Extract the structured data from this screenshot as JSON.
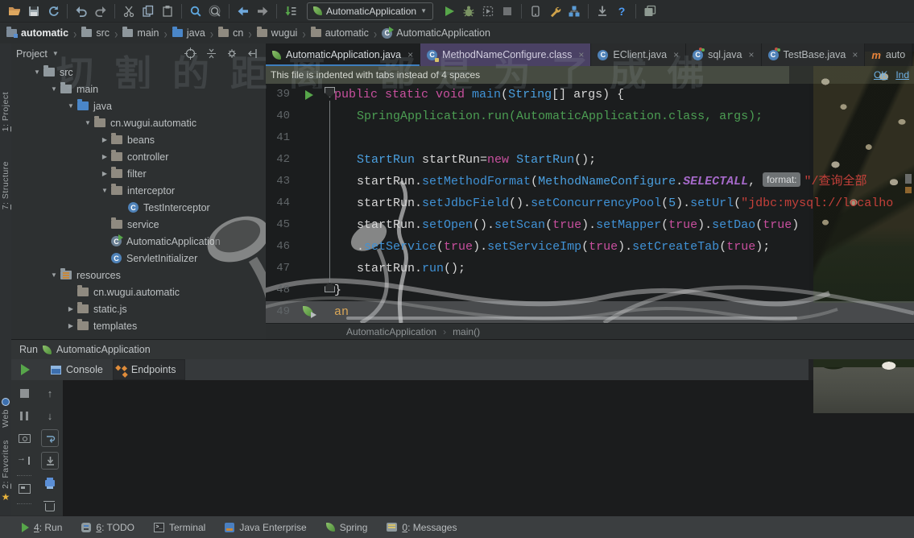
{
  "window": {
    "watermark": "切割的距离 都是为了成佛"
  },
  "toolbar": {
    "run_config": "AutomaticApplication"
  },
  "navbar": {
    "items": [
      {
        "label": "automatic",
        "icon": "project"
      },
      {
        "label": "src",
        "icon": "folder"
      },
      {
        "label": "main",
        "icon": "folder"
      },
      {
        "label": "java",
        "icon": "folder-blue"
      },
      {
        "label": "cn",
        "icon": "package"
      },
      {
        "label": "wugui",
        "icon": "package"
      },
      {
        "label": "automatic",
        "icon": "package"
      },
      {
        "label": "AutomaticApplication",
        "icon": "spring-class"
      }
    ]
  },
  "left_strip": {
    "top": [
      {
        "label": "1: Project",
        "icon": "project-tool"
      },
      {
        "label": "7: Structure",
        "icon": "structure-tool"
      }
    ],
    "bottom": [
      {
        "label": "Web",
        "icon": "web-tool"
      },
      {
        "label": "2: Favorites",
        "icon": "favorites-tool"
      }
    ]
  },
  "project_panel": {
    "title": "Project",
    "tree": [
      {
        "label": "src",
        "depth": 1,
        "arrow": "down",
        "icon": "folder"
      },
      {
        "label": "main",
        "depth": 2,
        "arrow": "down",
        "icon": "folder"
      },
      {
        "label": "java",
        "depth": 3,
        "arrow": "down",
        "icon": "folder-blue"
      },
      {
        "label": "cn.wugui.automatic",
        "depth": 4,
        "arrow": "down",
        "icon": "package"
      },
      {
        "label": "beans",
        "depth": 5,
        "arrow": "right",
        "icon": "package"
      },
      {
        "label": "controller",
        "depth": 5,
        "arrow": "right",
        "icon": "package"
      },
      {
        "label": "filter",
        "depth": 5,
        "arrow": "right",
        "icon": "package"
      },
      {
        "label": "interceptor",
        "depth": 5,
        "arrow": "down",
        "icon": "package"
      },
      {
        "label": "TestInterceptor",
        "depth": 6,
        "arrow": "none",
        "icon": "class"
      },
      {
        "label": "service",
        "depth": 5,
        "arrow": "none",
        "icon": "package"
      },
      {
        "label": "AutomaticApplication",
        "depth": 5,
        "arrow": "none",
        "icon": "spring-class"
      },
      {
        "label": "ServletInitializer",
        "depth": 5,
        "arrow": "none",
        "icon": "class"
      },
      {
        "label": "resources",
        "depth": 2,
        "arrow": "down",
        "icon": "resources"
      },
      {
        "label": "cn.wugui.automatic",
        "depth": 3,
        "arrow": "none",
        "icon": "package"
      },
      {
        "label": "static.js",
        "depth": 3,
        "arrow": "right",
        "icon": "package"
      },
      {
        "label": "templates",
        "depth": 3,
        "arrow": "right",
        "icon": "package"
      }
    ]
  },
  "editor": {
    "tabs": [
      {
        "label": "AutomaticApplication.java",
        "icon": "spring-boot-class",
        "state": "active",
        "close": true
      },
      {
        "label": "MethodNameConfigure.class",
        "icon": "class-locked",
        "state": "purple",
        "close": true
      },
      {
        "label": "EClient.java",
        "icon": "class",
        "state": "plain",
        "close": true
      },
      {
        "label": "sql.java",
        "icon": "class-modified",
        "state": "plain",
        "close": true
      },
      {
        "label": "TestBase.java",
        "icon": "class-modified",
        "state": "plain",
        "close": true
      },
      {
        "label": "auto",
        "icon": "maven",
        "state": "ghost",
        "close": false
      }
    ],
    "banner": {
      "text": "This file is indented with tabs instead of 4 spaces",
      "links": [
        "OK",
        "Ind"
      ]
    },
    "hint_label": "format:",
    "lines": [
      {
        "n": 39,
        "ind": 0,
        "run_icon": true,
        "seg": [
          [
            "kw",
            "public static void "
          ],
          [
            "m",
            "main"
          ],
          [
            "pl",
            "("
          ],
          [
            "type",
            "String"
          ],
          [
            "pl",
            "[] args) {"
          ]
        ]
      },
      {
        "n": 40,
        "ind": 1,
        "seg": [
          [
            "green",
            "SpringApplication.run(AutomaticApplication.class, args);"
          ]
        ]
      },
      {
        "n": 41,
        "ind": 0,
        "seg": []
      },
      {
        "n": 42,
        "ind": 1,
        "seg": [
          [
            "type",
            "StartRun"
          ],
          [
            "pl",
            " startRun="
          ],
          [
            "kw",
            "new"
          ],
          [
            "pl",
            " "
          ],
          [
            "type",
            "StartRun"
          ],
          [
            "pl",
            "();"
          ]
        ]
      },
      {
        "n": 43,
        "ind": 1,
        "seg": [
          [
            "pl",
            "startRun."
          ],
          [
            "m",
            "setMethodFormat"
          ],
          [
            "pl",
            "("
          ],
          [
            "type",
            "MethodNameConfigure"
          ],
          [
            "pl",
            "."
          ],
          [
            "sel",
            "SELECTALL"
          ],
          [
            "pl",
            ", "
          ],
          [
            "hint",
            "format:"
          ],
          [
            "str",
            "\"/查询全部"
          ]
        ]
      },
      {
        "n": 44,
        "ind": 1,
        "seg": [
          [
            "pl",
            "startRun."
          ],
          [
            "m",
            "setJdbcField"
          ],
          [
            "pl",
            "()."
          ],
          [
            "m",
            "setConcurrencyPool"
          ],
          [
            "pl",
            "("
          ],
          [
            "num",
            "5"
          ],
          [
            "pl",
            ")."
          ],
          [
            "m",
            "setUrl"
          ],
          [
            "pl",
            "("
          ],
          [
            "str",
            "\"jdbc:mysql://localho"
          ]
        ]
      },
      {
        "n": 45,
        "ind": 1,
        "seg": [
          [
            "pl",
            "startRun."
          ],
          [
            "m",
            "setOpen"
          ],
          [
            "pl",
            "()."
          ],
          [
            "m",
            "setScan"
          ],
          [
            "pl",
            "("
          ],
          [
            "bool",
            "true"
          ],
          [
            "pl",
            ")."
          ],
          [
            "m",
            "setMapper"
          ],
          [
            "pl",
            "("
          ],
          [
            "bool",
            "true"
          ],
          [
            "pl",
            ")."
          ],
          [
            "m",
            "setDao"
          ],
          [
            "pl",
            "("
          ],
          [
            "bool",
            "true"
          ],
          [
            "pl",
            ")"
          ]
        ]
      },
      {
        "n": 46,
        "ind": 1,
        "seg": [
          [
            "pl",
            "."
          ],
          [
            "m",
            "setService"
          ],
          [
            "pl",
            "("
          ],
          [
            "bool",
            "true"
          ],
          [
            "pl",
            ")."
          ],
          [
            "m",
            "setServiceImp"
          ],
          [
            "pl",
            "("
          ],
          [
            "bool",
            "true"
          ],
          [
            "pl",
            ")."
          ],
          [
            "m",
            "setCreateTab"
          ],
          [
            "pl",
            "("
          ],
          [
            "bool",
            "true"
          ],
          [
            "pl",
            ");"
          ]
        ]
      },
      {
        "n": 47,
        "ind": 1,
        "seg": [
          [
            "pl",
            "startRun."
          ],
          [
            "m",
            "run"
          ],
          [
            "pl",
            "();"
          ]
        ]
      },
      {
        "n": 48,
        "ind": 0,
        "fold_bottom": true,
        "seg": [
          [
            "pl",
            "}"
          ]
        ]
      },
      {
        "n": 49,
        "ind": 0,
        "spring_icon": true,
        "current": true,
        "seg": [
          [
            "caret",
            "an"
          ]
        ]
      }
    ],
    "breadcrumb": [
      "AutomaticApplication",
      "main()"
    ]
  },
  "run_panel": {
    "label": "Run",
    "config": "AutomaticApplication",
    "tabs": [
      {
        "label": "Console",
        "icon": "console",
        "selected": false
      },
      {
        "label": "Endpoints",
        "icon": "endpoints",
        "selected": true
      }
    ]
  },
  "status_bar": {
    "items": [
      {
        "label": "4: Run",
        "icon": "run",
        "mnemonic": true
      },
      {
        "label": "6: TODO",
        "icon": "todo",
        "mnemonic": true
      },
      {
        "label": "Terminal",
        "icon": "terminal",
        "mnemonic": false
      },
      {
        "label": "Java Enterprise",
        "icon": "javaee",
        "mnemonic": false
      },
      {
        "label": "Spring",
        "icon": "spring",
        "mnemonic": false
      },
      {
        "label": "0: Messages",
        "icon": "messages",
        "mnemonic": true
      }
    ]
  },
  "palette": {
    "accent_tab_underline": "#3d7dbd",
    "keyword": "#c8509e",
    "method": "#4092d6",
    "class_type": "#4ba0e0",
    "string": "#c5403a",
    "constant_italic": "#a569c9",
    "call_chain_green": "#4c9e53",
    "caret_word": "#d8a657",
    "run_green": "#57a64a",
    "maven_orange": "#e8833a"
  }
}
